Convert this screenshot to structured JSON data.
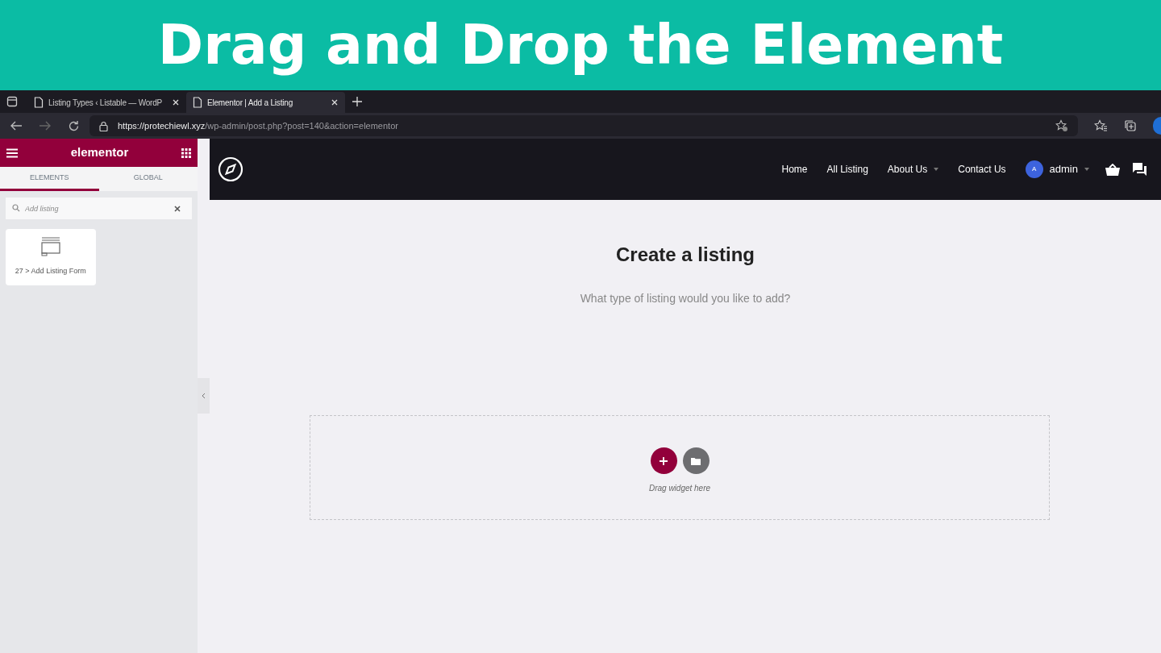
{
  "banner": {
    "title": "Drag and Drop the Element"
  },
  "browser": {
    "tabs": [
      {
        "title": "Listing Types ‹ Listable — WordP",
        "selected": false
      },
      {
        "title": "Elementor | Add a Listing",
        "selected": true
      }
    ],
    "url": "**https://protechiewl.xyz**/wp-admin/post.php?post=140&action=elementor"
  },
  "panel": {
    "logo": "elementor",
    "tabs": [
      {
        "label": "ELEMENTS",
        "selected": true
      },
      {
        "label": "GLOBAL",
        "selected": false
      }
    ],
    "search": {
      "value": "Add listing"
    },
    "widgets": [
      {
        "label": "27 > Add Listing Form"
      }
    ]
  },
  "site": {
    "nav": [
      {
        "label": "Home",
        "dropdown": false
      },
      {
        "label": "All Listing",
        "dropdown": false
      },
      {
        "label": "About Us",
        "dropdown": true
      },
      {
        "label": "Contact Us",
        "dropdown": false
      }
    ],
    "user": {
      "initial": "A",
      "name": "admin"
    },
    "heading": "Create a listing",
    "subheading": "What type of listing would you like to add?",
    "dropzone": {
      "hint": "Drag widget here"
    }
  }
}
